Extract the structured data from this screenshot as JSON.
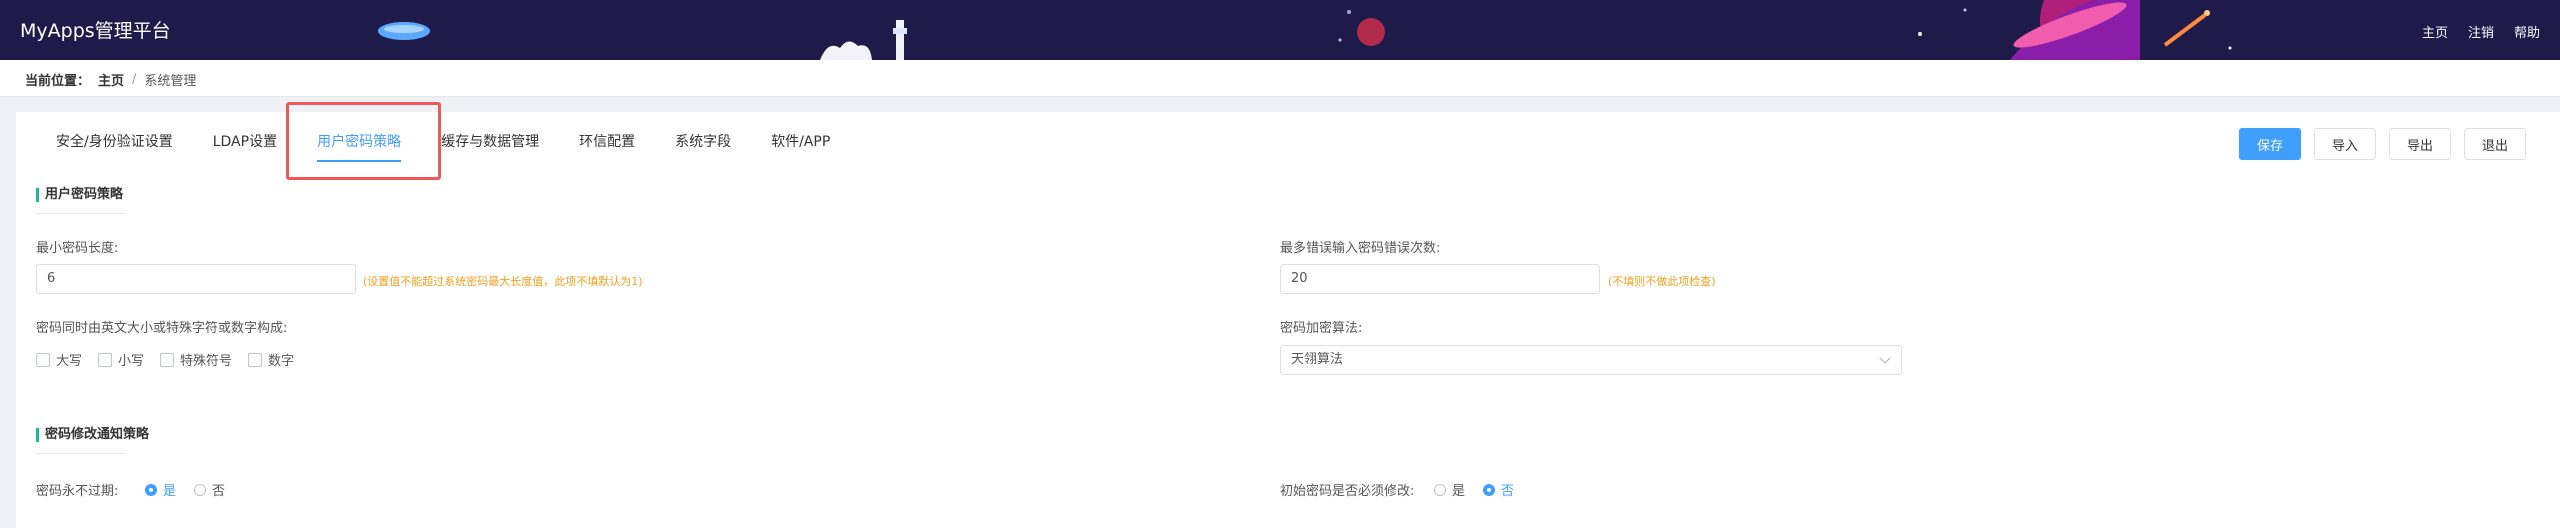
{
  "app": {
    "title": "MyApps管理平台"
  },
  "topnav": {
    "home": "主页",
    "logout": "注销",
    "help": "帮助"
  },
  "breadcrumb": {
    "label": "当前位置：",
    "home": "主页",
    "separator": "/",
    "current": "系统管理"
  },
  "tabs": [
    {
      "label": "安全/身份验证设置"
    },
    {
      "label": "LDAP设置"
    },
    {
      "label": "用户密码策略"
    },
    {
      "label": "缓存与数据管理"
    },
    {
      "label": "环信配置"
    },
    {
      "label": "系统字段"
    },
    {
      "label": "软件/APP"
    }
  ],
  "actions": {
    "save": "保存",
    "import": "导入",
    "export": "导出",
    "exit": "退出"
  },
  "section1": {
    "title": "用户密码策略",
    "min_length_label": "最小密码长度:",
    "min_length_value": "6",
    "min_length_hint": "(设置值不能超过系统密码最大长度值，此项不填默认为1)",
    "max_errors_label": "最多错误输入密码错误次数:",
    "max_errors_value": "20",
    "max_errors_hint": "(不填则不做此项检查)",
    "composition_label": "密码同时由英文大小或特殊字符或数字构成:",
    "composition_options": [
      "大写",
      "小写",
      "特殊符号",
      "数字"
    ],
    "encrypt_label": "密码加密算法:",
    "encrypt_value": "天翎算法"
  },
  "section2": {
    "title": "密码修改通知策略",
    "never_expire_label": "密码永不过期:",
    "never_expire_yes": "是",
    "never_expire_no": "否",
    "force_change_label": "初始密码是否必须修改:",
    "force_change_yes": "是",
    "force_change_no": "否"
  },
  "colors": {
    "header_bg": "#1e1b4b",
    "accent": "#409eff",
    "section_bar": "#1bb99a",
    "hint": "#f0a020",
    "highlight": "#f25757"
  }
}
